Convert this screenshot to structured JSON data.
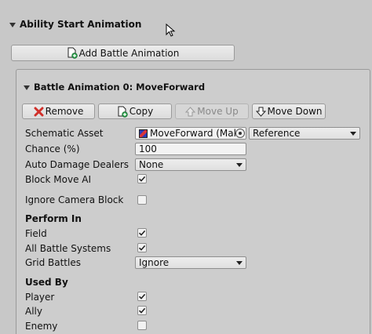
{
  "header": {
    "title": "Ability Start Animation"
  },
  "add_button": {
    "label": "Add Battle Animation",
    "icon": "add-document-icon"
  },
  "panel": {
    "title": "Battle Animation 0: MoveForward",
    "buttons": {
      "remove": "Remove",
      "copy": "Copy",
      "move_up": "Move Up",
      "move_down": "Move Down"
    },
    "fields": {
      "schematic_asset_label": "Schematic Asset",
      "schematic_asset_value": "MoveForward (Makin",
      "schematic_reference": "Reference",
      "chance_label": "Chance (%)",
      "chance_value": "100",
      "auto_damage_label": "Auto Damage Dealers",
      "auto_damage_value": "None",
      "block_move_label": "Block Move AI",
      "block_move_checked": true,
      "ignore_camera_label": "Ignore Camera Block",
      "ignore_camera_checked": false
    },
    "perform_in": {
      "heading": "Perform In",
      "field_label": "Field",
      "field_checked": true,
      "all_systems_label": "All Battle Systems",
      "all_systems_checked": true,
      "grid_label": "Grid Battles",
      "grid_value": "Ignore"
    },
    "used_by": {
      "heading": "Used By",
      "player_label": "Player",
      "player_checked": true,
      "ally_label": "Ally",
      "ally_checked": true,
      "enemy_label": "Enemy",
      "enemy_checked": false
    }
  },
  "colors": {
    "background": "#c8c8c8",
    "remove_icon": "#d0302a",
    "add_icon": "#2ea44f"
  }
}
